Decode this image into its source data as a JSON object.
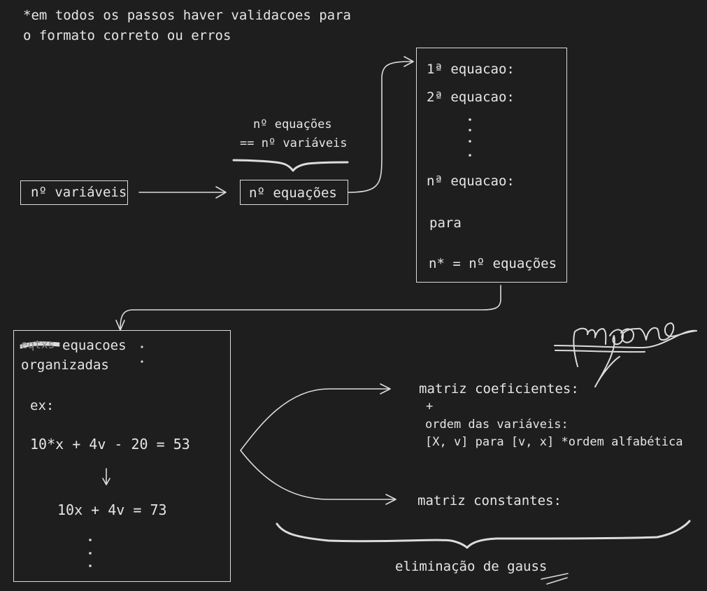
{
  "note": {
    "line1": "*em todos os passos haver validacoes para",
    "line2": "o formato correto ou erros"
  },
  "vars_box": {
    "label": "nº variáveis"
  },
  "eq_box": {
    "label": "nº equações"
  },
  "constraint": {
    "line1": "nº equações",
    "line2": "== nº variáveis"
  },
  "equations_box": {
    "line1": "1ª equacao:",
    "line2": "2ª equacao:",
    "line3": "nª equacao:",
    "para": "para",
    "n_def": "n* = nº equações"
  },
  "organized_box": {
    "strike_word": "eqtxs",
    "title_1": "equacoes",
    "title_2": "organizadas",
    "ex": "ex:",
    "example_in": "10*x + 4v - 20 = 53",
    "example_out": "10x + 4v = 73"
  },
  "coef": {
    "title": "matriz coeficientes:",
    "plus": "+",
    "order": "ordem das variáveis:",
    "order_example": "[X, v] para [v, x] *ordem alfabética"
  },
  "const": {
    "title": "matriz constantes:"
  },
  "gauss": {
    "label": "eliminação de gauss"
  },
  "colors": {
    "background": "#1e1e1e",
    "stroke": "#dcdcdc",
    "text": "#e6e6e6"
  }
}
